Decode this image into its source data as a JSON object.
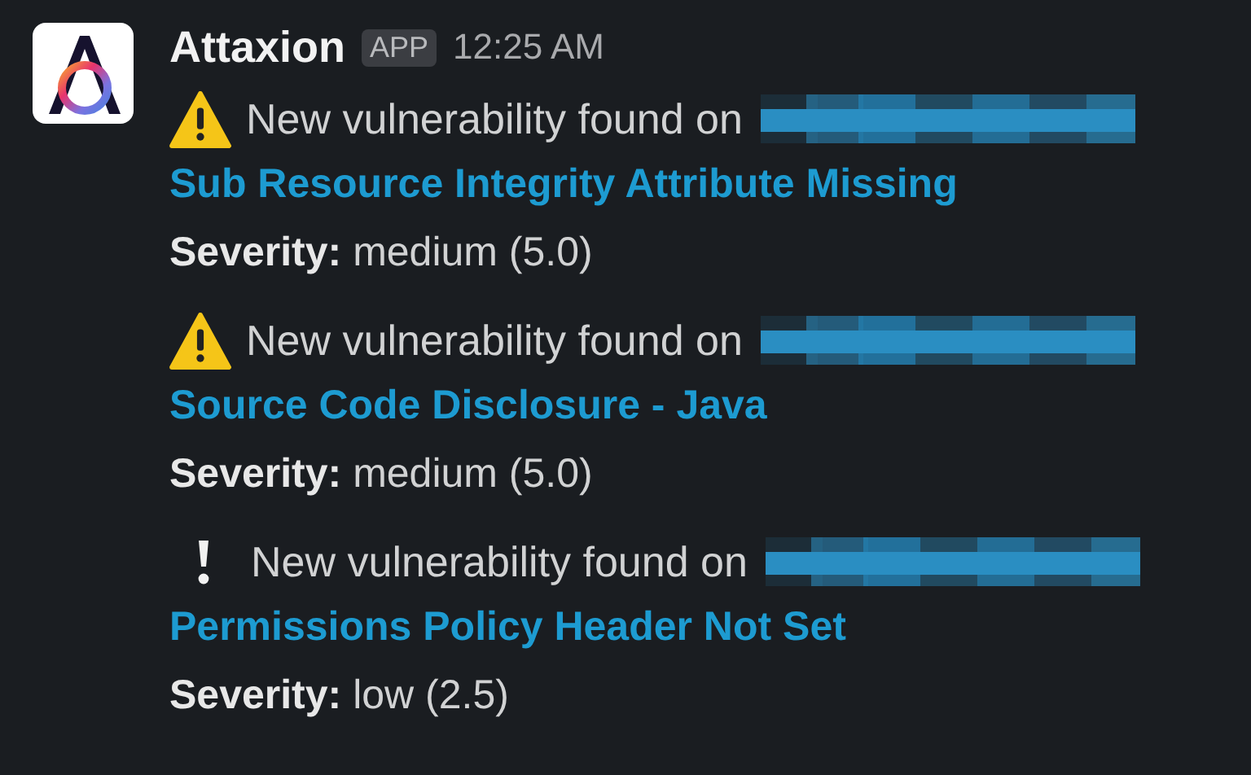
{
  "message": {
    "sender": "Attaxion",
    "badge": "APP",
    "time": "12:25 AM",
    "alerts": [
      {
        "kind": "warning",
        "text": "New vulnerability found on",
        "title": "Sub Resource Integrity Attribute Missing",
        "severity": "**Severity:** medium (5.0)"
      },
      {
        "kind": "warning",
        "text": "New vulnerability found on",
        "title": "Source Code Disclosure - Java",
        "severity": "**Severity:** medium (5.0)"
      },
      {
        "kind": "exclamation",
        "text": "New vulnerability found on",
        "title": "Permissions Policy Header Not Set",
        "severity": "**Severity:** low (2.5)"
      }
    ]
  }
}
